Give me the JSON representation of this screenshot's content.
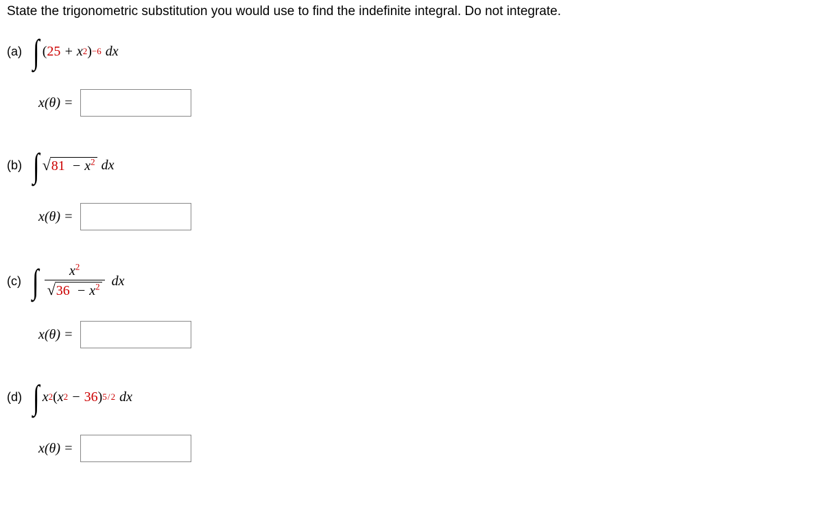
{
  "prompt": "State the trigonometric substitution you would use to find the indefinite integral. Do not integrate.",
  "parts": {
    "a": {
      "label": "(a)",
      "coeff": "25",
      "exp": "6",
      "answer_label": "x(θ) =",
      "value": ""
    },
    "b": {
      "label": "(b)",
      "coeff": "81",
      "answer_label": "x(θ) =",
      "value": ""
    },
    "c": {
      "label": "(c)",
      "coeff": "36",
      "answer_label": "x(θ) =",
      "value": ""
    },
    "d": {
      "label": "(d)",
      "coeff": "36",
      "exp_num": "5",
      "exp_den": "2",
      "answer_label": "x(θ) =",
      "value": ""
    }
  }
}
